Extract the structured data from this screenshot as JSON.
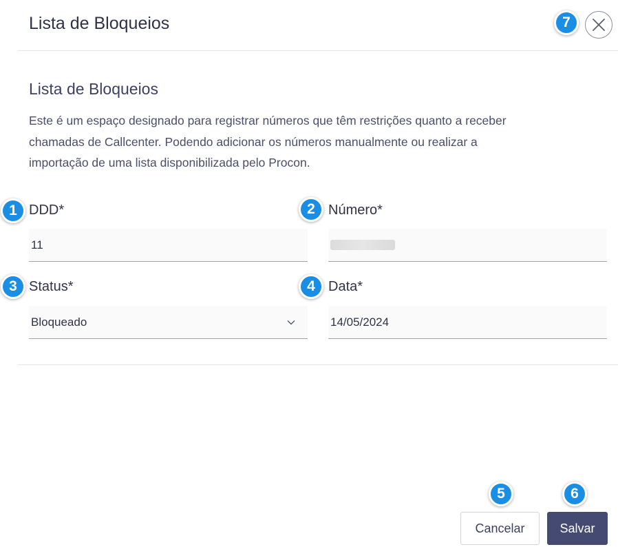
{
  "header": {
    "title": "Lista de Bloqueios",
    "close_icon": "close-icon"
  },
  "section": {
    "title": "Lista de Bloqueios",
    "description_lines": [
      "Este é um espaço designado para registrar números que têm restrições quanto a receber",
      "chamadas de Callcenter. Podendo adicionar os números manualmente ou realizar a",
      "importação de uma lista disponibilizada pelo Procon."
    ]
  },
  "fields": {
    "ddd": {
      "label": "DDD*",
      "value": "11"
    },
    "numero": {
      "label": "Número*",
      "value": ""
    },
    "status": {
      "label": "Status*",
      "value": "Bloqueado",
      "icon": "chevron-down-icon"
    },
    "data": {
      "label": "Data*",
      "value": "14/05/2024"
    }
  },
  "footer": {
    "cancel_label": "Cancelar",
    "save_label": "Salvar"
  },
  "annotations": {
    "badges": [
      "1",
      "2",
      "3",
      "4",
      "5",
      "6",
      "7"
    ],
    "color": "#1a8ee4"
  },
  "colors": {
    "primary_button": "#454a72",
    "text": "#2f3348"
  }
}
